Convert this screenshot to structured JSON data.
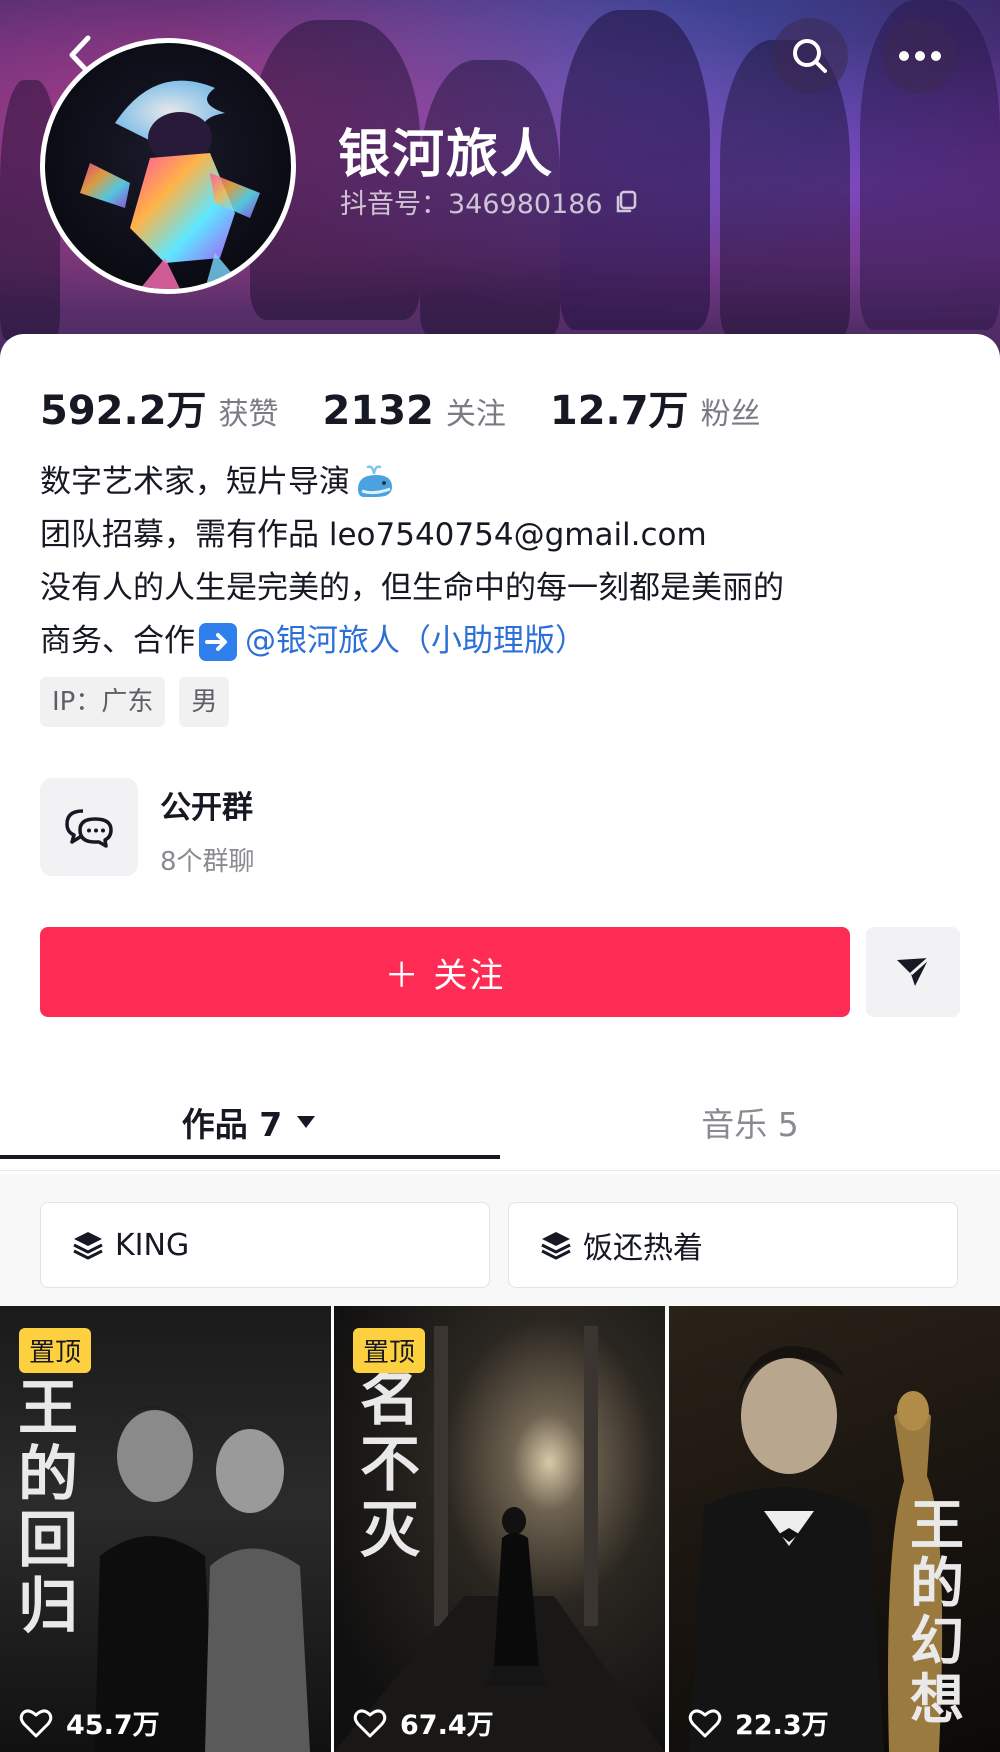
{
  "profile": {
    "name": "银河旅人",
    "douyin_id": "抖音号：346980186"
  },
  "stats": [
    {
      "value": "592.2万",
      "label": "获赞"
    },
    {
      "value": "2132",
      "label": "关注"
    },
    {
      "value": "12.7万",
      "label": "粉丝"
    }
  ],
  "bio": {
    "line1": "数字艺术家，短片导演",
    "line2": "团队招募，需有作品 leo7540754@gmail.com",
    "line3": "没有人的人生是完美的，但生命中的每一刻都是美丽的",
    "line4_prefix": "商务、合作",
    "line4_mention": "@银河旅人（小助理版）"
  },
  "tags": [
    "IP：广东",
    "男"
  ],
  "group": {
    "title": "公开群",
    "subtitle": "8个群聊"
  },
  "actions": {
    "follow_label": "＋ 关注"
  },
  "tabs": {
    "works": "作品 7",
    "music": "音乐 5"
  },
  "collections": [
    "KING",
    "饭还热着"
  ],
  "videos": [
    {
      "badge": "置顶",
      "title": "王的回归",
      "likes": "45.7万"
    },
    {
      "badge": "置顶",
      "title": "名不灭",
      "likes": "67.4万"
    },
    {
      "badge": "",
      "title": "王的幻想",
      "likes": "22.3万"
    }
  ],
  "icons": {
    "back": "back-arrow-icon",
    "search": "search-icon",
    "more": "more-icon",
    "copy": "copy-icon",
    "chat": "chat-bubbles-icon",
    "share": "send-icon",
    "dropdown": "triangle-down-icon",
    "collection": "layers-icon",
    "like": "heart-icon"
  },
  "colors": {
    "primary": "#fe2c55",
    "pin_badge": "#fcd03f",
    "mention": "#2c6fd6"
  }
}
